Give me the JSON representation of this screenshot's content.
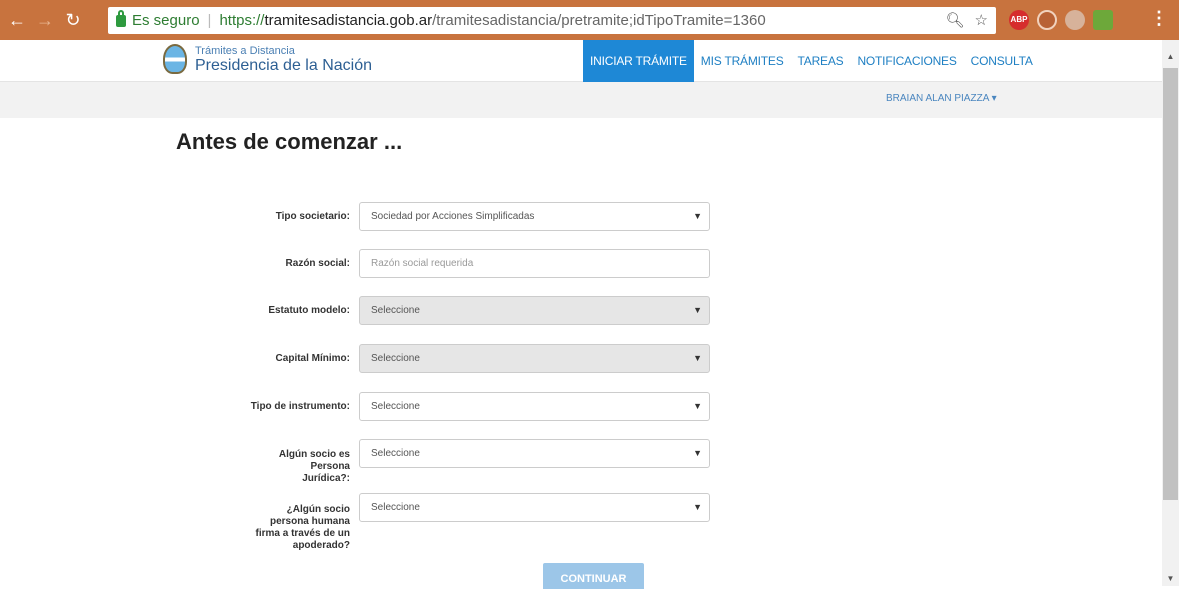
{
  "browser": {
    "secure_label": "Es seguro",
    "url_scheme": "https://",
    "url_host": "tramitesadistancia.gob.ar",
    "url_path": "/tramitesadistancia/pretramite;idTipoTramite=1360",
    "ext_abp": "ABP"
  },
  "site": {
    "logo_sub": "Trámites a Distancia",
    "logo_main": "Presidencia de la Nación",
    "nav": [
      "INICIAR TRÁMITE",
      "MIS TRÁMITES",
      "TAREAS",
      "NOTIFICACIONES",
      "CONSULTA"
    ],
    "user": "BRAIAN ALAN PIAZZA ▾"
  },
  "form": {
    "title": "Antes de comenzar ...",
    "fields": [
      {
        "label": "Tipo societario:",
        "value": "Sociedad por Acciones Simplificadas"
      },
      {
        "label": "Razón social:",
        "placeholder": "Razón social requerida"
      },
      {
        "label": "Estatuto modelo:",
        "value": "Seleccione"
      },
      {
        "label": "Capital Mínimo:",
        "value": "Seleccione"
      },
      {
        "label": "Tipo de instrumento:",
        "value": "Seleccione"
      },
      {
        "label": "Algún socio es Persona Jurídica?:",
        "value": "Seleccione"
      },
      {
        "label": "¿Algún socio persona humana firma a través de un apoderado?",
        "value": "Seleccione"
      }
    ],
    "continue_label": "CONTINUAR"
  }
}
